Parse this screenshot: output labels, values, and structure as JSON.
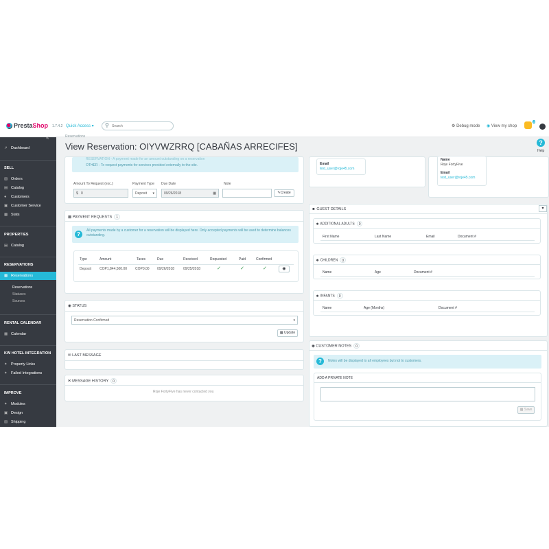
{
  "header": {
    "brand_pre": "Presta",
    "brand_post": "Shop",
    "version": "1.7.4.2",
    "quick_access": "Quick Access ▾",
    "search_placeholder": "Search",
    "debug_mode": "Debug mode",
    "view_shop": "View my shop",
    "notifications_count": "3"
  },
  "page": {
    "breadcrumb": "Reservations",
    "title": "View Reservation: OIYVWZRRQ [CABAÑAS ARRECIFES]",
    "help_label": "Help"
  },
  "sidebar": {
    "collapse": "«",
    "dashboard": "Dashboard",
    "sell": "SELL",
    "orders": "Orders",
    "catalog": "Catalog",
    "customers": "Customers",
    "customer_service": "Customer Service",
    "stats": "Stats",
    "properties": "PROPERTIES",
    "prop_catalog": "Catalog",
    "reservations_head": "RESERVATIONS",
    "reservations": "Reservations",
    "sub_reservations": "Reservations",
    "sub_statuses": "Statuses",
    "sub_sources": "Sources",
    "rental_calendar": "RENTAL CALENDAR",
    "calendar": "Calendar",
    "integration": "KW HOTEL INTEGRATION",
    "property_links": "Property Links",
    "failed_integrations": "Failed Integrations",
    "improve": "IMPROVE",
    "modules": "Modules",
    "design": "Design",
    "shipping": "Shipping"
  },
  "payment_form": {
    "info_line1": "RESERVATION - A payment made for an amount outstanding on a reservation",
    "info_line2": "OTHER - To request payments for services provided externally to the site.",
    "amount_label": "Amount To Request (exc.)",
    "payment_type_label": "Payment Type",
    "due_date_label": "Due Date",
    "note_label": "Note",
    "currency_symbol": "$",
    "amount_value": "0",
    "payment_type_value": "Deposit",
    "due_date_value": "09/26/2018",
    "create_label": "Create"
  },
  "payment_requests": {
    "title": "PAYMENT REQUESTS",
    "count": "1",
    "info": "All payments made by a customer for a reservation will be displayed here. Only accepted payments will be used to determine balances outstanding.",
    "columns": [
      "Type",
      "Amount",
      "Taxes",
      "Due",
      "Received",
      "Requested",
      "Paid",
      "Confirmed"
    ],
    "rows": [
      {
        "type": "Deposit",
        "amount": "COP1,844,500.00",
        "taxes": "COP0.00",
        "due": "09/26/2018",
        "received": "09/25/2018"
      }
    ]
  },
  "status": {
    "title": "STATUS",
    "value": "Reservation Confirmed",
    "update_label": "Update"
  },
  "last_message": {
    "title": "LAST MESSAGE"
  },
  "message_history": {
    "title": "MESSAGE HISTORY",
    "count": "0",
    "empty": "Roje FortyFive has never contacted you"
  },
  "customer": {
    "email_label": "Email",
    "email": "test_user@roje45.com",
    "name_label": "Name",
    "name": "Roje FortyFive",
    "email_label2": "Email",
    "email2": "test_user@roje45.com"
  },
  "guest_details": {
    "title": "GUEST DETAILS",
    "adults_title": "ADDITIONAL ADULTS",
    "adults_count": "0",
    "adults_cols": [
      "First Name",
      "Last Name",
      "Email",
      "Document #"
    ],
    "children_title": "CHILDREN",
    "children_count": "0",
    "children_cols": [
      "Name",
      "Age",
      "Document #"
    ],
    "infants_title": "INFANTS",
    "infants_count": "0",
    "infants_cols": [
      "Name",
      "Age (Months)",
      "Document #"
    ]
  },
  "customer_notes": {
    "title": "CUSTOMER NOTES",
    "count": "0",
    "info": "Notes will be displayed to all employees but not to customers.",
    "private_title": "ADD A PRIVATE NOTE",
    "save_label": "Save"
  }
}
